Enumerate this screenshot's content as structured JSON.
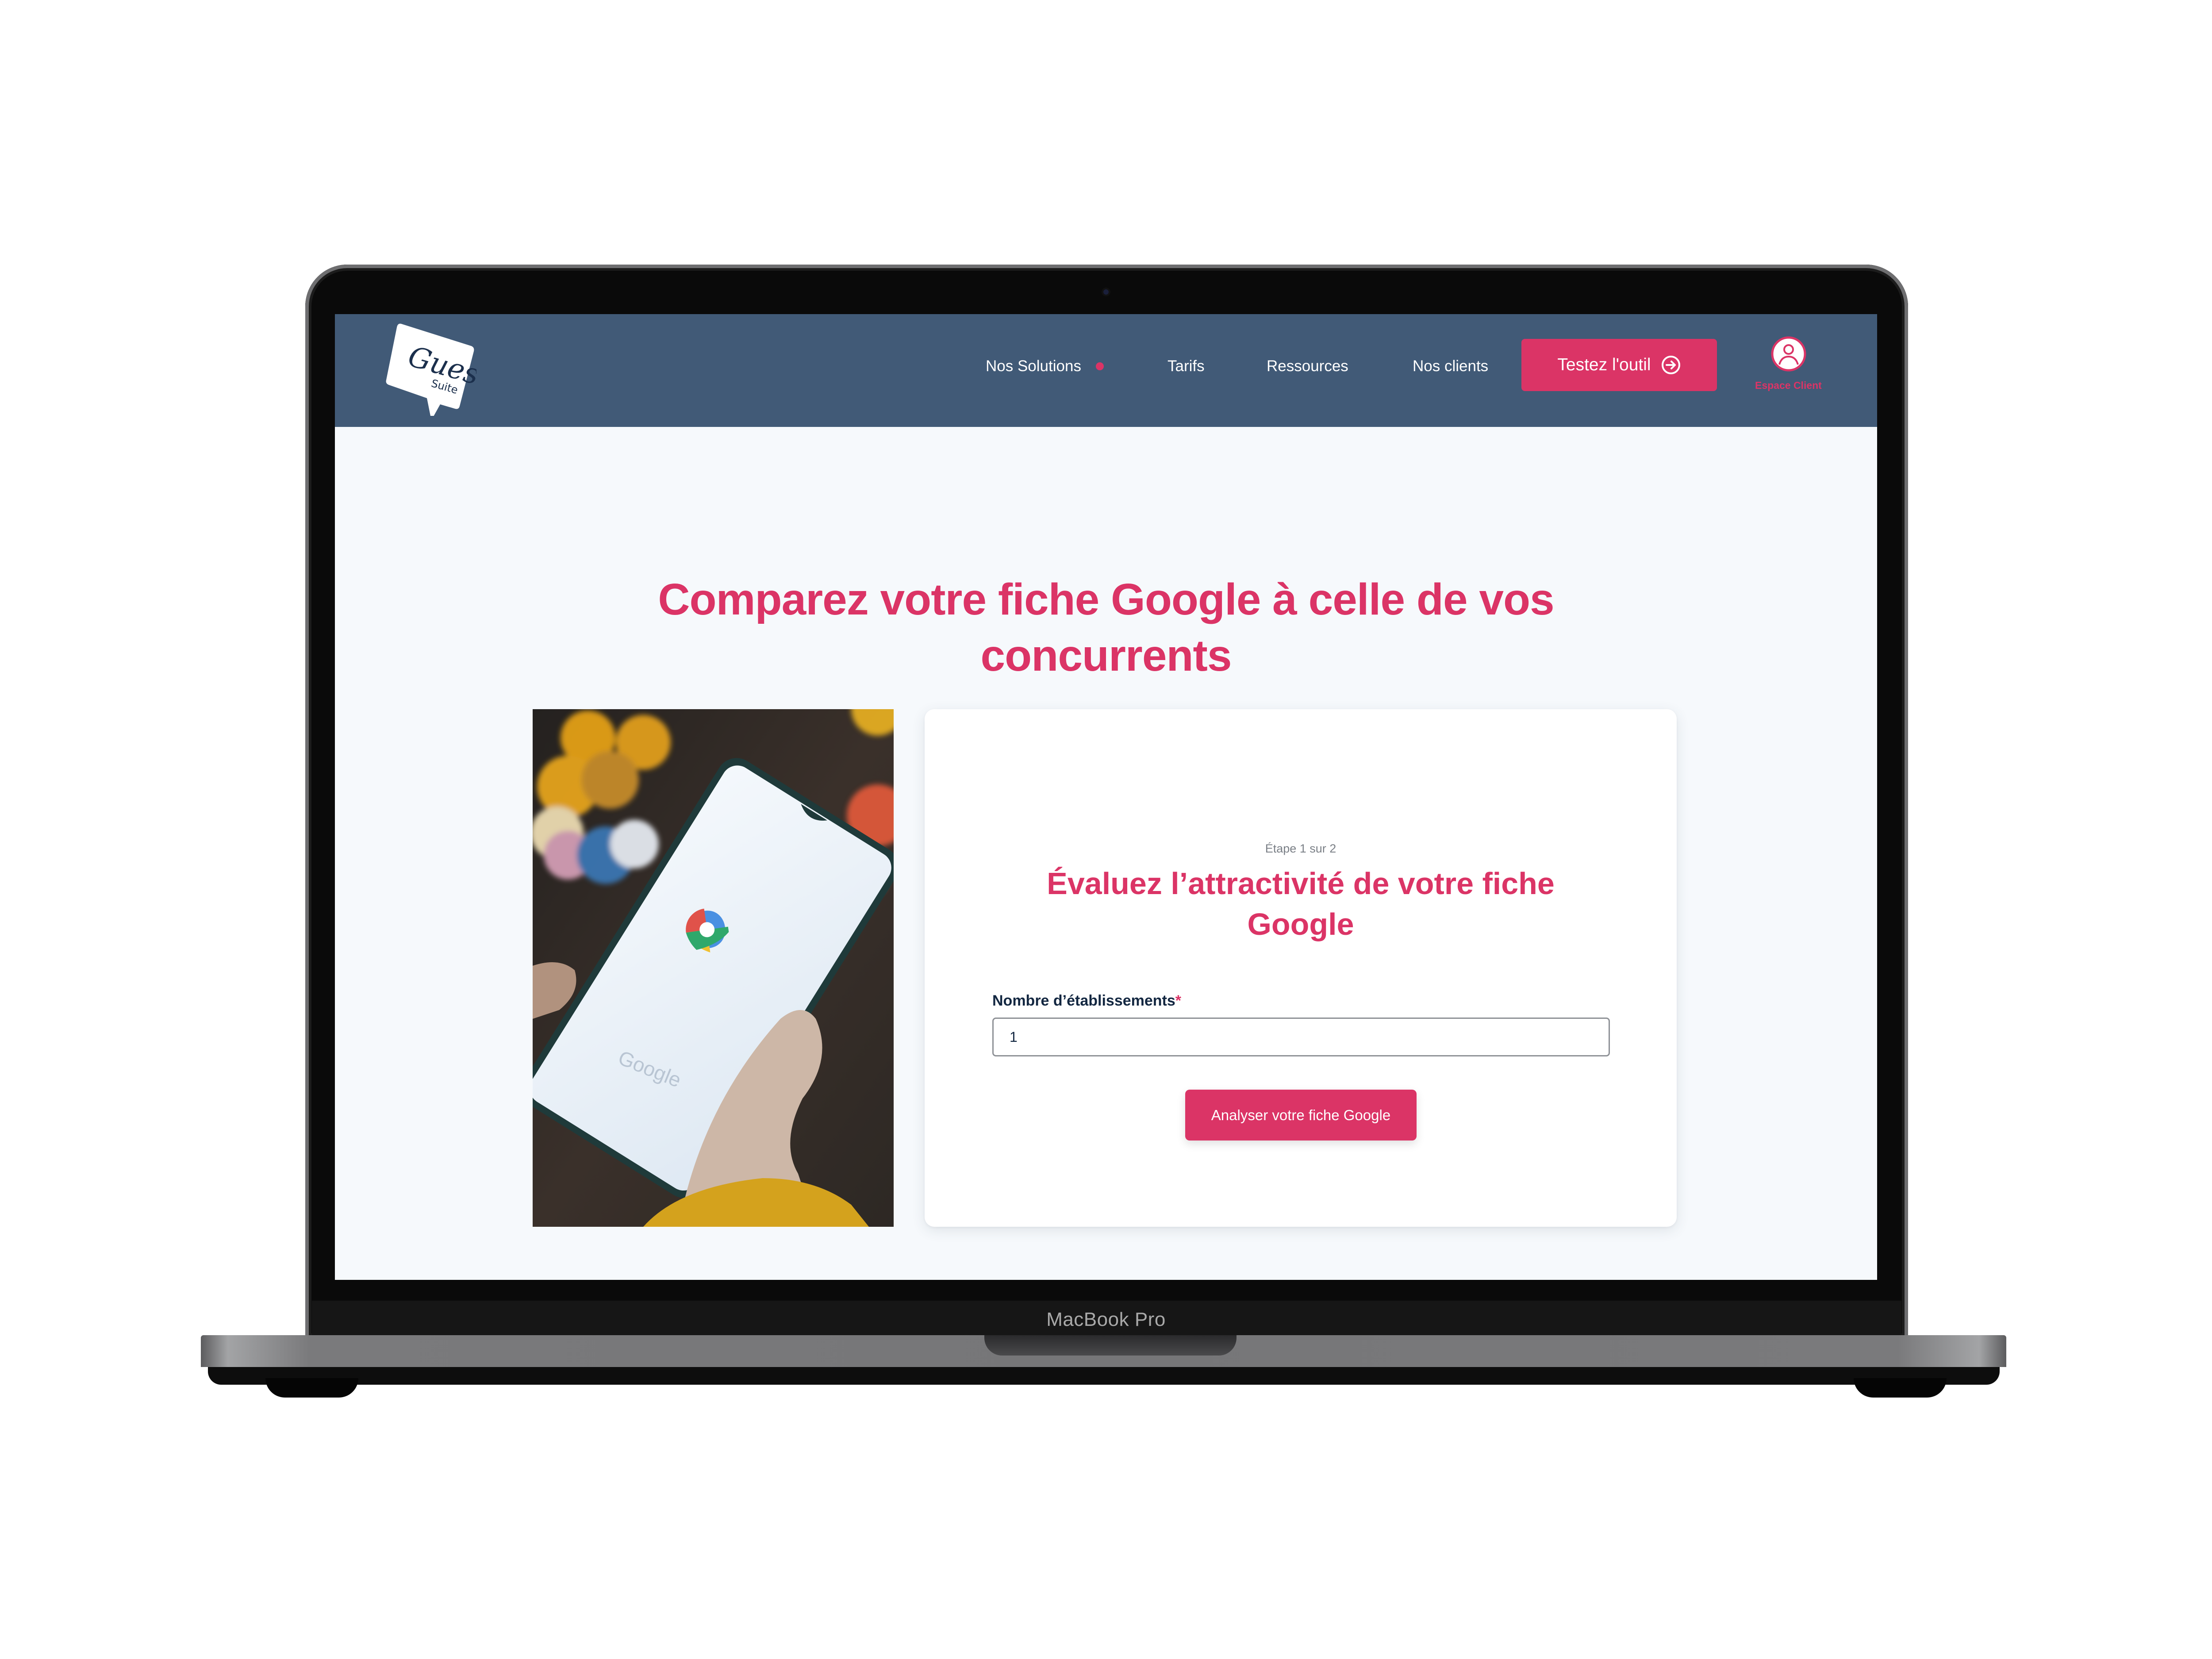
{
  "device": {
    "label": "MacBook Pro"
  },
  "brand": {
    "name": "Guest",
    "subname": "Suite",
    "colors": {
      "primary": "#db3466",
      "navbar": "#415a77",
      "page_bg": "#f6f9fc",
      "text_dark": "#132741"
    }
  },
  "nav": {
    "items": [
      {
        "label": "Nos Solutions",
        "has_dot": true
      },
      {
        "label": "Tarifs"
      },
      {
        "label": "Ressources"
      },
      {
        "label": "Nos clients"
      }
    ],
    "cta_label": "Testez l'outil",
    "cta_icon": "arrow-right-circle-icon",
    "account_label": "Espace Client",
    "account_icon": "user-circle-icon"
  },
  "hero": {
    "title_line1": "Comparez votre fiche Google à celle de vos",
    "title_line2": "concurrents",
    "image_alt": "Hand holding smartphone showing Google Maps"
  },
  "form": {
    "step": "Étape 1 sur 2",
    "title_line1": "Évaluez l’attractivité de votre fiche",
    "title_line2": "Google",
    "field_label": "Nombre d’établissements",
    "required_mark": "*",
    "field_value": "1",
    "submit_label": "Analyser votre fiche Google"
  }
}
